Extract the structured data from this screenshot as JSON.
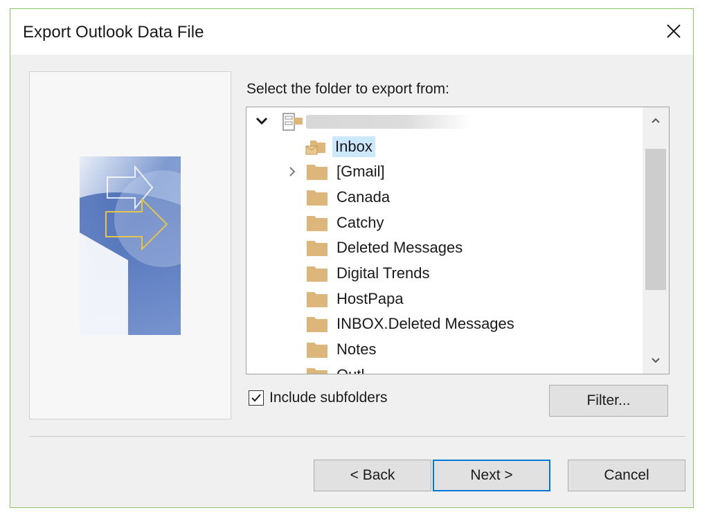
{
  "dialog": {
    "title": "Export Outlook Data File",
    "prompt": "Select the folder to export from:",
    "include_subfolders_label": "Include subfolders",
    "include_subfolders_checked": true,
    "filter_label": "Filter...",
    "back_label": "< Back",
    "next_label": "Next >",
    "cancel_label": "Cancel"
  },
  "tree": {
    "account_expanded": true,
    "folders": [
      {
        "label": "Inbox",
        "selected": true,
        "has_children": false,
        "icon": "inbox-icon"
      },
      {
        "label": "[Gmail]",
        "selected": false,
        "has_children": true,
        "icon": "folder-icon"
      },
      {
        "label": "Canada",
        "selected": false,
        "has_children": false,
        "icon": "folder-icon"
      },
      {
        "label": "Catchy",
        "selected": false,
        "has_children": false,
        "icon": "folder-icon"
      },
      {
        "label": "Deleted Messages",
        "selected": false,
        "has_children": false,
        "icon": "folder-icon"
      },
      {
        "label": "Digital Trends",
        "selected": false,
        "has_children": false,
        "icon": "folder-icon"
      },
      {
        "label": "HostPapa",
        "selected": false,
        "has_children": false,
        "icon": "folder-icon"
      },
      {
        "label": "INBOX.Deleted Messages",
        "selected": false,
        "has_children": false,
        "icon": "folder-icon"
      },
      {
        "label": "Notes",
        "selected": false,
        "has_children": false,
        "icon": "folder-icon"
      },
      {
        "label": "Outl...",
        "selected": false,
        "has_children": false,
        "icon": "folder-icon"
      }
    ]
  },
  "colors": {
    "selection": "#cce8ff",
    "folder": "#dcb67a",
    "primary_border": "#0078d7",
    "dialog_border": "#8cc466"
  }
}
